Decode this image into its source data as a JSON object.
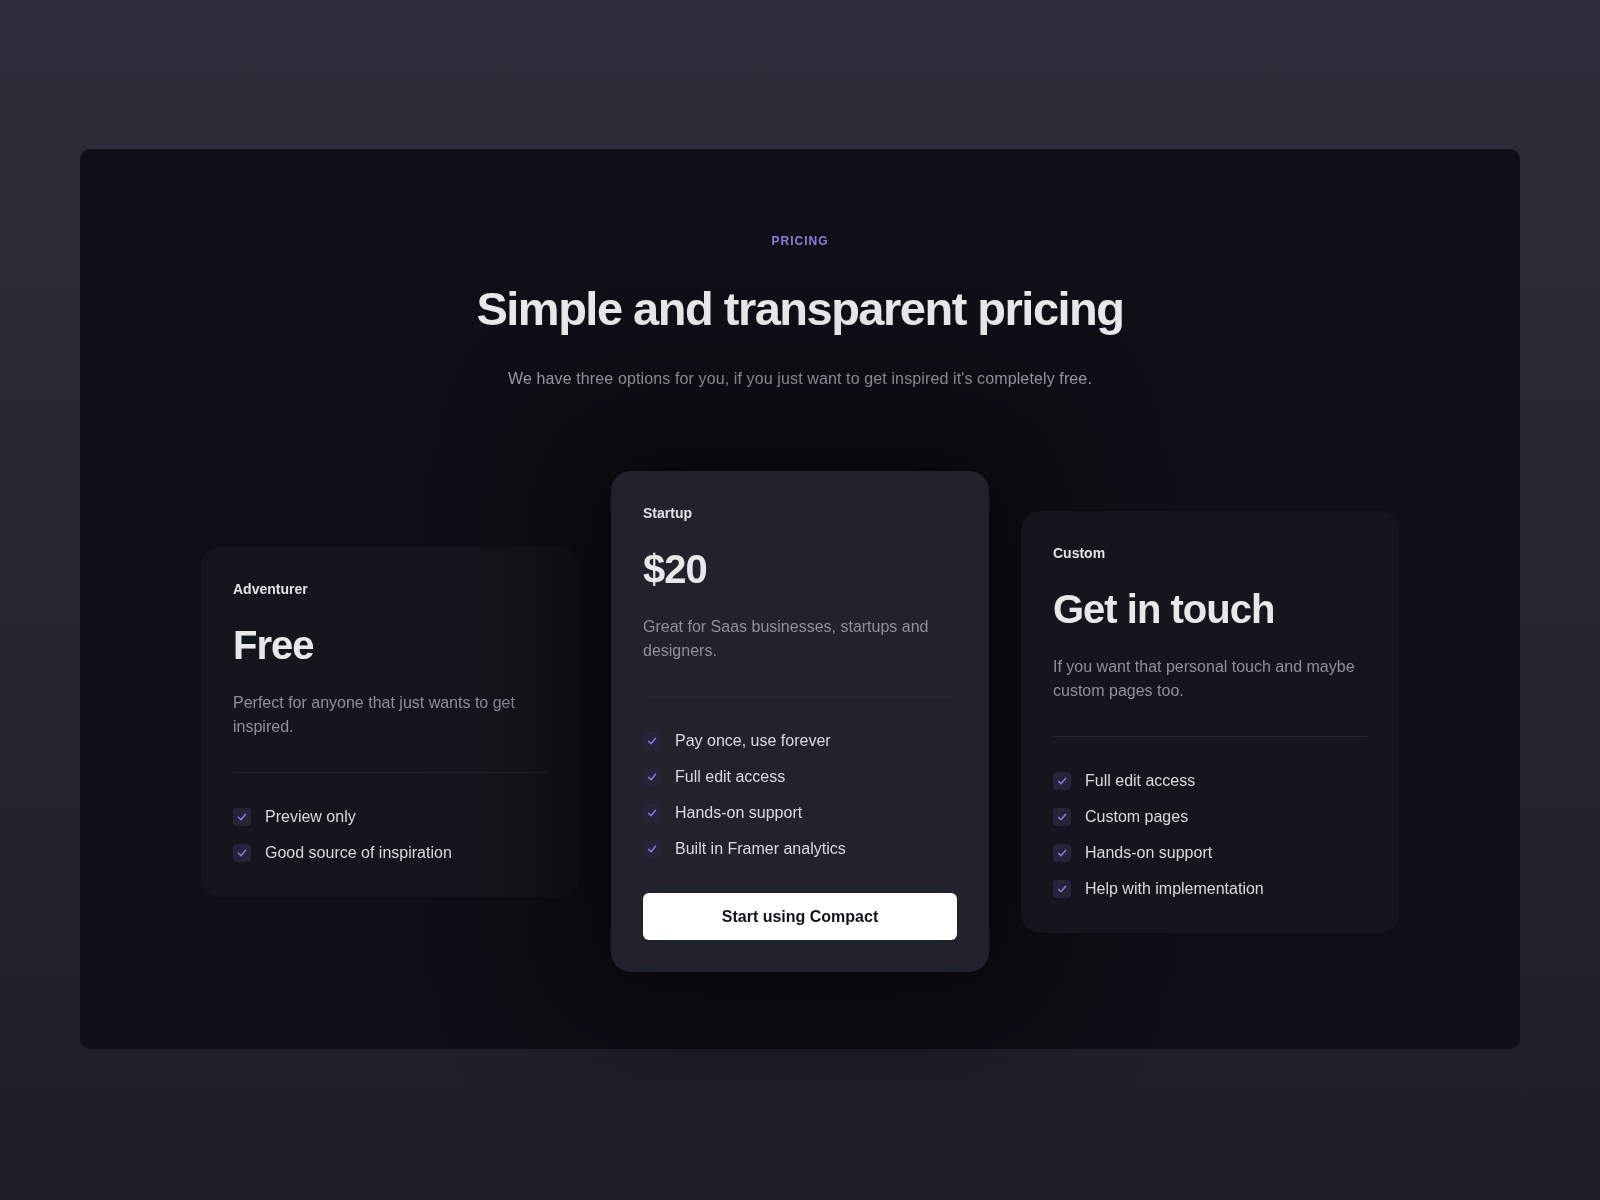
{
  "section": {
    "eyebrow": "PRICING",
    "title": "Simple and transparent pricing",
    "subtitle": "We have three options for you, if you just want to get inspired it's completely free."
  },
  "plans": [
    {
      "name": "Adventurer",
      "price": "Free",
      "description": "Perfect for anyone that just wants to get inspired.",
      "featured": false,
      "features": [
        "Preview only",
        "Good source of inspiration"
      ]
    },
    {
      "name": "Startup",
      "price": "$20",
      "description": "Great for Saas businesses, startups and designers.",
      "featured": true,
      "features": [
        "Pay once, use forever",
        "Full edit access",
        "Hands-on support",
        "Built in Framer analytics"
      ],
      "button": "Start using Compact"
    },
    {
      "name": "Custom",
      "price": "Get in touch",
      "description": "If you want that personal touch and maybe custom pages too.",
      "featured": false,
      "features": [
        "Full edit access",
        "Custom pages",
        "Hands-on support",
        "Help with implementation"
      ]
    }
  ]
}
